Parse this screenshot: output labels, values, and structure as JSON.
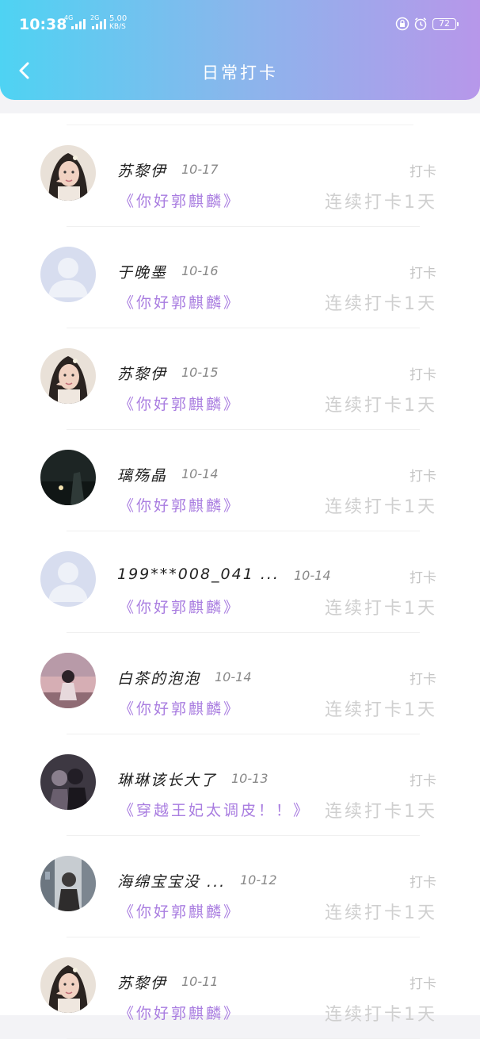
{
  "status_bar": {
    "time": "10:38",
    "signal1": "4G",
    "signal2": "2G",
    "speed_value": "5.00",
    "speed_unit": "KB/S",
    "battery": "72"
  },
  "header": {
    "title": "日常打卡"
  },
  "records": [
    {
      "name": "苏黎伊",
      "date": "10-17",
      "action": "打卡",
      "book": "《你好郭麒麟》",
      "streak": "连续打卡1天",
      "avatar": "girl-portrait"
    },
    {
      "name": "于晚墨",
      "date": "10-16",
      "action": "打卡",
      "book": "《你好郭麒麟》",
      "streak": "连续打卡1天",
      "avatar": "default-user"
    },
    {
      "name": "苏黎伊",
      "date": "10-15",
      "action": "打卡",
      "book": "《你好郭麒麟》",
      "streak": "连续打卡1天",
      "avatar": "girl-portrait"
    },
    {
      "name": "璃殇晶",
      "date": "10-14",
      "action": "打卡",
      "book": "《你好郭麒麟》",
      "streak": "连续打卡1天",
      "avatar": "night-scene"
    },
    {
      "name": "199***008_041 ...",
      "date": "10-14",
      "action": "打卡",
      "book": "《你好郭麒麟》",
      "streak": "连续打卡1天",
      "avatar": "default-user"
    },
    {
      "name": "白茶的泡泡",
      "date": "10-14",
      "action": "打卡",
      "book": "《你好郭麒麟》",
      "streak": "连续打卡1天",
      "avatar": "pink-sky-girl"
    },
    {
      "name": "琳琳该长大了",
      "date": "10-13",
      "action": "打卡",
      "book": "《穿越王妃太调皮！！》",
      "streak": "连续打卡1天",
      "avatar": "dark-couple"
    },
    {
      "name": "海绵宝宝没 ...",
      "date": "10-12",
      "action": "打卡",
      "book": "《你好郭麒麟》",
      "streak": "连续打卡1天",
      "avatar": "street-photo"
    },
    {
      "name": "苏黎伊",
      "date": "10-11",
      "action": "打卡",
      "book": "《你好郭麒麟》",
      "streak": "连续打卡1天",
      "avatar": "girl-portrait"
    }
  ]
}
